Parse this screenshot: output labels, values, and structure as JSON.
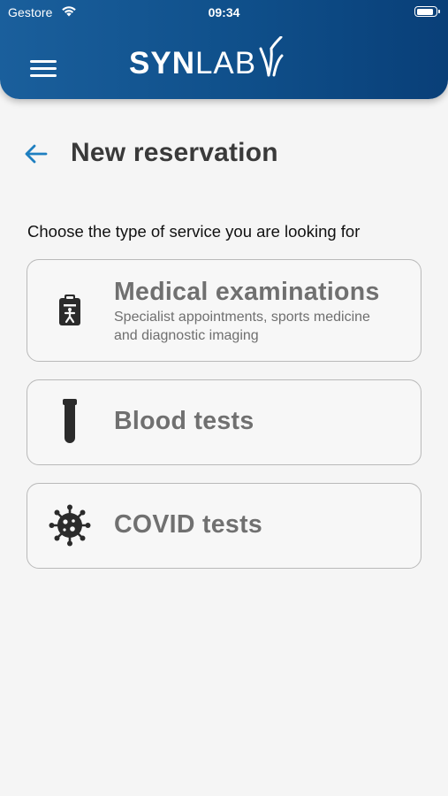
{
  "status_bar": {
    "carrier": "Gestore",
    "time": "09:34"
  },
  "header": {
    "logo_bold": "SYN",
    "logo_light": "LAB"
  },
  "page": {
    "title": "New reservation",
    "subtitle": "Choose the type of service you are looking for"
  },
  "services": [
    {
      "title": "Medical examinations",
      "description": "Specialist appointments, sports medicine and diagnostic imaging",
      "icon": "clipboard-icon"
    },
    {
      "title": "Blood tests",
      "icon": "test-tube-icon"
    },
    {
      "title": "COVID tests",
      "icon": "virus-icon"
    }
  ],
  "colors": {
    "header_blue": "#0f4f8a",
    "accent_blue": "#1e7fc0",
    "card_border": "#b9b9b9",
    "card_text": "#707070"
  }
}
